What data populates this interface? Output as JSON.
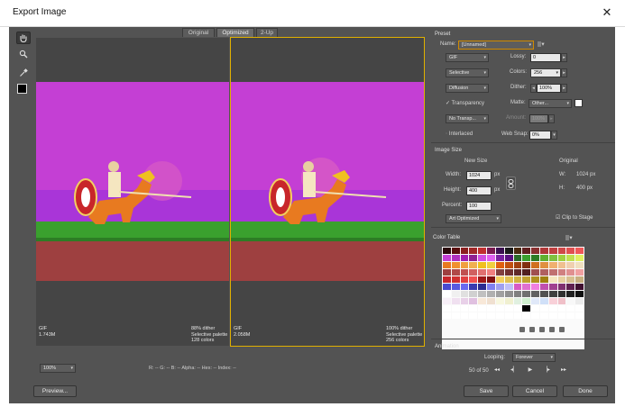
{
  "window": {
    "title": "Export Image",
    "close_label": "✕"
  },
  "tabs": [
    "Original",
    "Optimized",
    "2-Up"
  ],
  "panes": [
    {
      "format": "GIF",
      "size": "1.743M",
      "dither": "88% dither",
      "palette": "Selective palette",
      "colors": "128 colors"
    },
    {
      "format": "GIF",
      "size": "2.058M",
      "dither": "100% dither",
      "palette": "Selective palette",
      "colors": "256 colors"
    }
  ],
  "preset": {
    "heading": "Preset",
    "name_label": "Name:",
    "name_value": "[Unnamed]",
    "format": "GIF",
    "lossy_label": "Lossy:",
    "lossy_value": "0",
    "reduction": "Selective",
    "colors_label": "Colors:",
    "colors_value": "256",
    "dither_algo": "Diffusion",
    "dither_label": "Dither:",
    "dither_value": "100%",
    "transparency_label": "Transparency",
    "matte_label": "Matte:",
    "matte_value": "Other...",
    "transparency_dither": "No Transp...",
    "amount_label": "Amount:",
    "amount_value": "100%",
    "interlaced_label": "Interlaced",
    "websnap_label": "Web Snap:",
    "websnap_value": "0%"
  },
  "image_size": {
    "heading": "Image Size",
    "new_size": "New Size",
    "original": "Original",
    "width_label": "Width:",
    "width_value": "1024",
    "height_label": "Height:",
    "height_value": "400",
    "unit": "px",
    "percent_label": "Percent:",
    "percent_value": "100",
    "orig_w_label": "W:",
    "orig_w_value": "1024 px",
    "orig_h_label": "H:",
    "orig_h_value": "400 px",
    "resample": "Art Optimized",
    "clip_label": "Clip to Stage"
  },
  "color_table": {
    "heading": "Color Table"
  },
  "animation": {
    "heading": "Animation",
    "looping_label": "Looping:",
    "looping_value": "Forever",
    "frame_counter": "50 of 50"
  },
  "footer": {
    "zoom": "100%",
    "channels": "R: --   G: --   B: --   Alpha: --   Hex: --   Index: --",
    "preview_label": "Preview...",
    "save_label": "Save",
    "cancel_label": "Cancel",
    "done_label": "Done"
  },
  "colors": {
    "accent": "#e0b000",
    "sky": "#c43fd4",
    "ground": "#9e4040",
    "grass": "#3aa02e"
  }
}
